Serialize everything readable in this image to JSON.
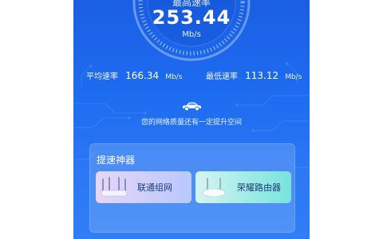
{
  "speed_test": {
    "highest_label": "最高速率",
    "highest_value": "253.44",
    "highest_unit": "Mb/s",
    "average_label": "平均速率",
    "average_value": "166.34",
    "average_unit": "Mb/s",
    "lowest_label": "最低速率",
    "lowest_value": "113.12",
    "lowest_unit": "Mb/s"
  },
  "hint": "您的网络质量还有一定提升空间",
  "booster": {
    "title": "提速神器",
    "items": [
      {
        "label": "联通组网",
        "icon": "router-icon"
      },
      {
        "label": "荣耀路由器",
        "icon": "router-icon"
      }
    ]
  },
  "colors": {
    "background_top": "#1a5fe4",
    "background_bottom": "#2f7ef6",
    "tile_a": "#b7c9ff",
    "tile_b": "#78e3dc"
  }
}
